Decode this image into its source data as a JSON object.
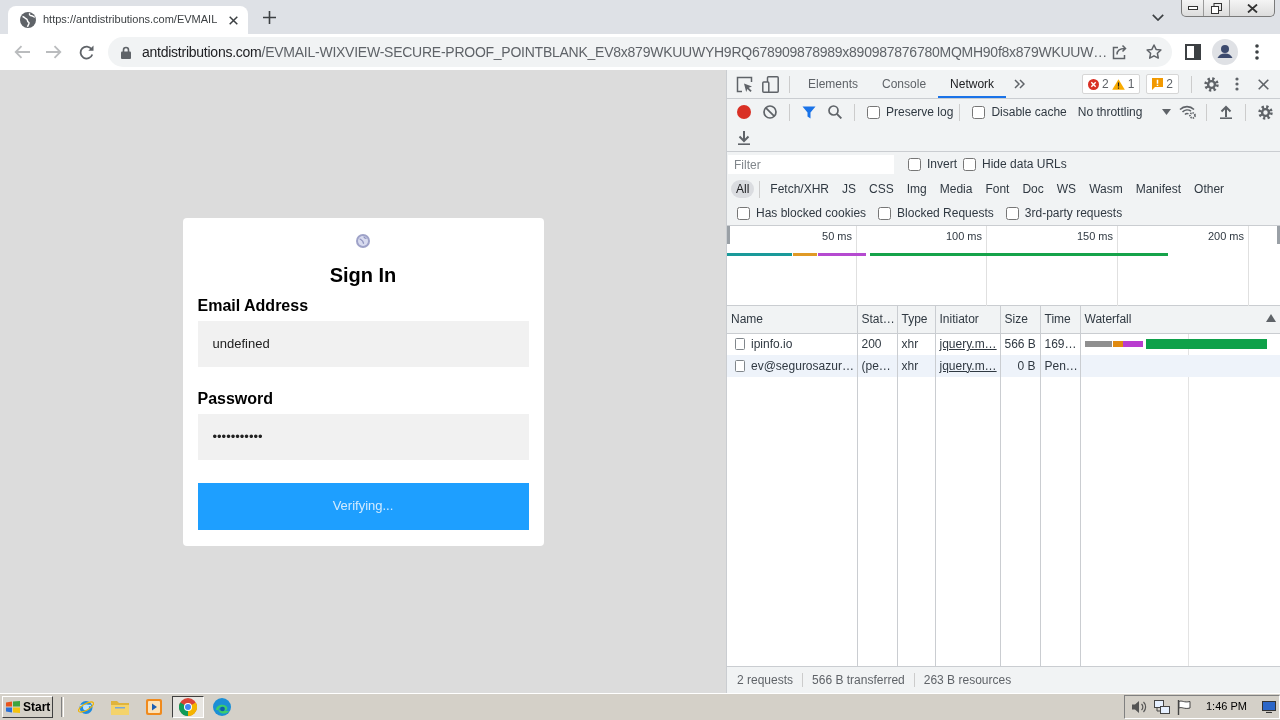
{
  "browser": {
    "tab": {
      "title": "https://antdistributions.com/EVMAIL"
    },
    "address_bar": {
      "host": "antdistributions.com",
      "path": "/EVMAIL-WIXVIEW-SECURE-PROOF_POINTBLANK_EV8x879WKUUWYH9RQ678909878989x890987876780MQMH90f8x879WKUUW…"
    }
  },
  "page": {
    "title": "Sign In",
    "fields": [
      {
        "label": "Email Address",
        "value": "undefined"
      },
      {
        "label": "Password",
        "value": "•••••••••••"
      }
    ],
    "submit": "Verifying..."
  },
  "devtools": {
    "tabs": [
      {
        "label": "Elements",
        "selected": false
      },
      {
        "label": "Console",
        "selected": false
      },
      {
        "label": "Network",
        "selected": true
      }
    ],
    "errors": "2",
    "warnings": "1",
    "issues": "2",
    "toolbar": {
      "recording": true,
      "options": [
        {
          "label": "Preserve log",
          "checked": false
        },
        {
          "label": "Disable cache",
          "checked": false
        }
      ],
      "throttling": "No throttling"
    },
    "filter": {
      "placeholder": "Filter",
      "options": [
        {
          "label": "Invert",
          "checked": false
        },
        {
          "label": "Hide data URLs",
          "checked": false
        }
      ]
    },
    "type_filters": [
      {
        "label": "All",
        "selected": true
      },
      {
        "label": "Fetch/XHR",
        "selected": false
      },
      {
        "label": "JS",
        "selected": false
      },
      {
        "label": "CSS",
        "selected": false
      },
      {
        "label": "Img",
        "selected": false
      },
      {
        "label": "Media",
        "selected": false
      },
      {
        "label": "Font",
        "selected": false
      },
      {
        "label": "Doc",
        "selected": false
      },
      {
        "label": "WS",
        "selected": false
      },
      {
        "label": "Wasm",
        "selected": false
      },
      {
        "label": "Manifest",
        "selected": false
      },
      {
        "label": "Other",
        "selected": false
      }
    ],
    "request_filters": [
      {
        "label": "Has blocked cookies",
        "checked": false
      },
      {
        "label": "Blocked Requests",
        "checked": false
      },
      {
        "label": "3rd-party requests",
        "checked": false
      }
    ],
    "overview": {
      "ticks": [
        "50 ms",
        "100 ms",
        "150 ms",
        "200 ms"
      ]
    },
    "table": {
      "columns": [
        "Name",
        "Stat…",
        "Type",
        "Initiator",
        "Size",
        "Time",
        "Waterfall"
      ],
      "rows": [
        {
          "name": "ipinfo.io",
          "status": "200",
          "type": "xhr",
          "initiator": "jquery.m…",
          "size": "566 B",
          "time": "169…",
          "pending": false
        },
        {
          "name": "ev@segurosazur…",
          "status": "(pe…",
          "type": "xhr",
          "initiator": "jquery.m…",
          "size": "0 B",
          "time": "Pen…",
          "pending": true
        }
      ]
    },
    "status_bar": [
      "2 requests",
      "566 B transferred",
      "263 B resources"
    ]
  },
  "taskbar": {
    "start": "Start",
    "apps": [
      {
        "kind": "ie",
        "selected": false
      },
      {
        "kind": "folder",
        "selected": false
      },
      {
        "kind": "media",
        "selected": false
      },
      {
        "kind": "chrome",
        "selected": true
      },
      {
        "kind": "edge",
        "selected": false
      }
    ],
    "clock": "1:46 PM"
  }
}
